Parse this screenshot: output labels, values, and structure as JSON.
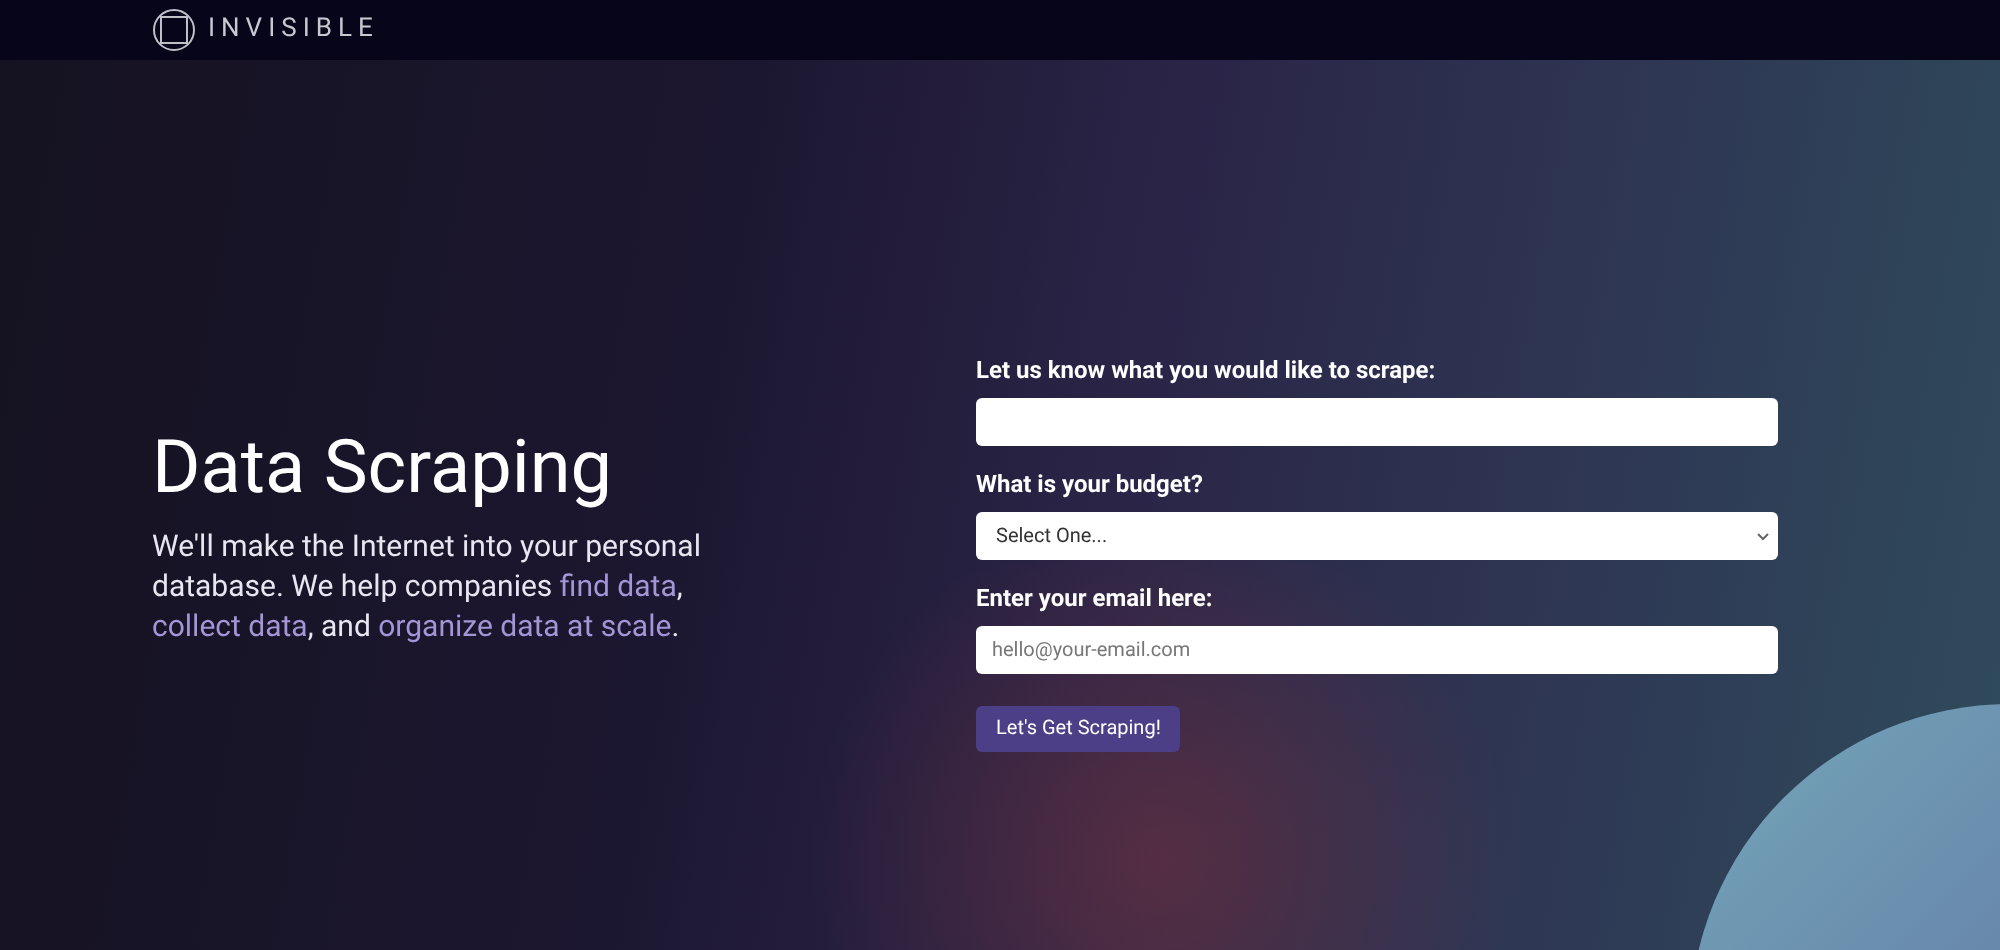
{
  "header": {
    "logo_text": "INVISIBLE"
  },
  "hero": {
    "title": "Data Scraping",
    "intro": [
      {
        "kind": "text",
        "text": "We'll make the Internet into your personal database. We help companies "
      },
      {
        "kind": "link",
        "text": "find data"
      },
      {
        "kind": "text",
        "text": ", "
      },
      {
        "kind": "link",
        "text": "collect data"
      },
      {
        "kind": "text",
        "text": ", and "
      },
      {
        "kind": "link",
        "text": "organize data at scale"
      },
      {
        "kind": "text",
        "text": "."
      }
    ]
  },
  "form": {
    "fields": [
      {
        "kind": "text",
        "label": "Let us know what you would like to scrape:"
      },
      {
        "kind": "select",
        "label": "What is your budget?",
        "value": "Select One..."
      },
      {
        "kind": "email",
        "label": "Enter your email here:",
        "placeholder": "hello@your-email.com"
      }
    ],
    "submit": "Let's Get Scraping!"
  }
}
